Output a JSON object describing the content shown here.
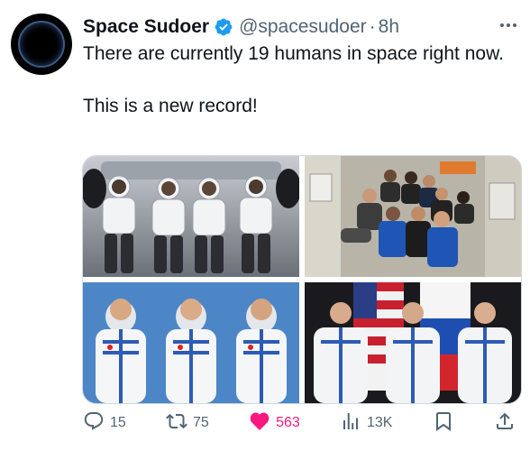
{
  "tweet": {
    "author_name": "Space Sudoer",
    "handle": "@spacesudoer",
    "separator": "·",
    "time": "8h",
    "text": "There are currently 19 humans in space right now.\n\nThis is a new record!",
    "media_count": 4
  },
  "actions": {
    "replies": "15",
    "retweets": "75",
    "likes": "563",
    "views": "13K"
  },
  "colors": {
    "verified": "#1d9bf0",
    "like": "#f91880",
    "secondary": "#536471"
  },
  "icons": [
    "more-icon",
    "verified-badge-icon",
    "reply-icon",
    "retweet-icon",
    "like-icon",
    "views-icon",
    "bookmark-icon",
    "share-icon"
  ]
}
